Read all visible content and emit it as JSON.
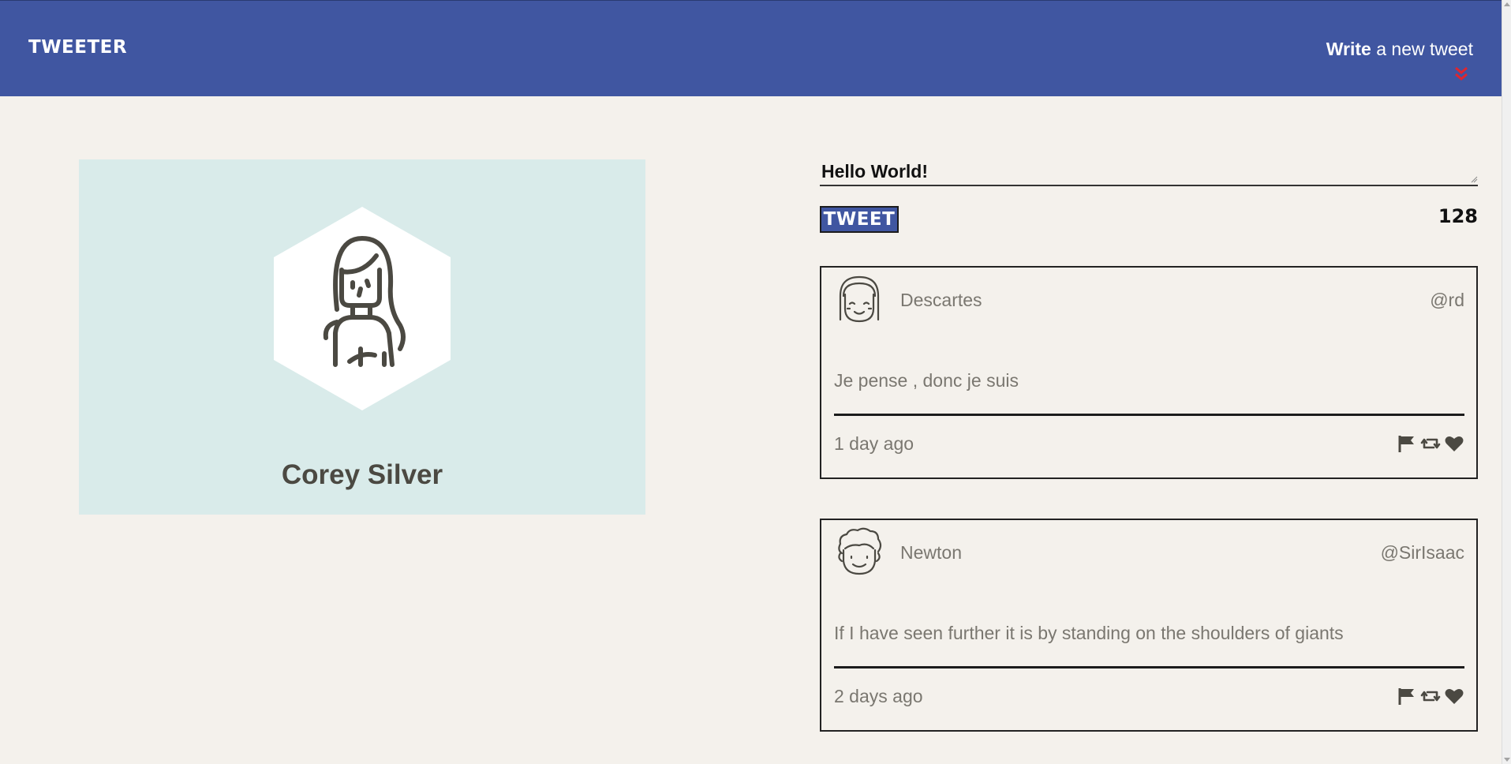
{
  "header": {
    "brand": "TWEETER",
    "compose_toggle": {
      "bold": "Write",
      "light": "a new tweet"
    }
  },
  "profile": {
    "name": "Corey Silver"
  },
  "compose": {
    "value": "Hello World!",
    "button_label": "TWEET",
    "char_count": "128"
  },
  "tweets": [
    {
      "name": "Descartes",
      "handle": "@rd",
      "text": "Je pense , donc je suis",
      "time": "1 day ago"
    },
    {
      "name": "Newton",
      "handle": "@SirIsaac",
      "text": "If I have seen further it is by standing on the shoulders of giants",
      "time": "2 days ago"
    }
  ],
  "colors": {
    "nav": "#4056a1",
    "page": "#f4f1ec",
    "profile_card": "#d9ebea",
    "chevron": "#e0252e",
    "icon": "#4b4942"
  },
  "icons": {
    "chevron": "double-chevron-down-icon",
    "flag": "flag-icon",
    "retweet": "retweet-icon",
    "heart": "heart-icon"
  }
}
